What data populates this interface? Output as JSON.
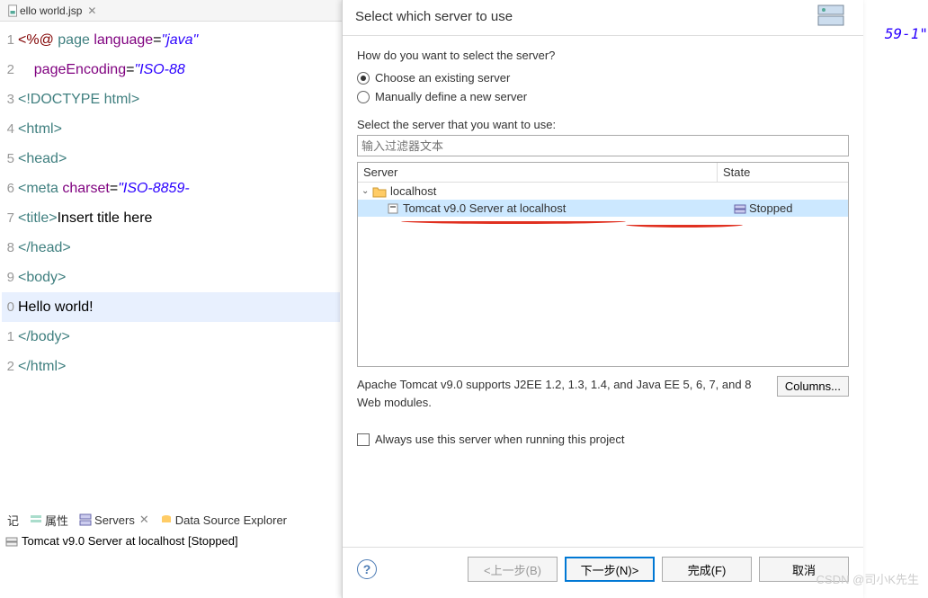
{
  "editor": {
    "tab_name": "ello world.jsp",
    "lines": [
      {
        "n": "1",
        "html": "<span class='tag-red'>&lt;%@</span> <span class='tag-teal'>page</span> <span class='attr-purple'>language</span>=<span class='attr-blue'>\"java\"</span>"
      },
      {
        "n": "2",
        "html": "    <span class='attr-purple'>pageEncoding</span>=<span class='attr-blue'>\"ISO-88</span>"
      },
      {
        "n": "3",
        "html": "<span class='tag-teal'>&lt;!DOCTYPE</span> <span class='tag-teal'>html&gt;</span>"
      },
      {
        "n": "4",
        "html": "<span class='tag-teal'>&lt;html&gt;</span>"
      },
      {
        "n": "5",
        "html": "<span class='tag-teal'>&lt;head&gt;</span>"
      },
      {
        "n": "6",
        "html": "<span class='tag-teal'>&lt;meta</span> <span class='attr-purple'>charset</span>=<span class='attr-blue'>\"ISO-8859-</span>"
      },
      {
        "n": "7",
        "html": "<span class='tag-teal'>&lt;title&gt;</span><span class='txt-black'>Insert title here</span>"
      },
      {
        "n": "8",
        "html": "<span class='tag-teal'>&lt;/head&gt;</span>"
      },
      {
        "n": "9",
        "html": "<span class='tag-teal'>&lt;body&gt;</span>"
      },
      {
        "n": "0",
        "html": "<span class='txt-black'>Hello world!</span>",
        "hl": true
      },
      {
        "n": "1",
        "html": "<span class='tag-teal'>&lt;/body&gt;</span>"
      },
      {
        "n": "2",
        "html": "<span class='tag-teal'>&lt;/html&gt;</span>"
      }
    ],
    "right_fragment": "59-1\""
  },
  "bottom": {
    "tabs": [
      "记",
      "属性",
      "Servers",
      "Data Source Explorer"
    ],
    "server_row": "Tomcat v9.0 Server at localhost  [Stopped]"
  },
  "dialog": {
    "title": "Select which server to use",
    "question": "How do you want to select the server?",
    "radio1": "Choose an existing server",
    "radio2": "Manually define a new server",
    "select_label": "Select the server that you want to use:",
    "filter_placeholder": "输入过滤器文本",
    "table": {
      "col_server": "Server",
      "col_state": "State",
      "root": "localhost",
      "item_name": "Tomcat v9.0 Server at localhost",
      "item_state": "Stopped"
    },
    "description": "Apache Tomcat v9.0 supports J2EE 1.2, 1.3, 1.4, and Java EE 5, 6, 7, and 8 Web modules.",
    "columns_btn": "Columns...",
    "checkbox_label": "Always use this server when running this project",
    "buttons": {
      "back": "<上一步(B)",
      "next": "下一步(N)>",
      "finish": "完成(F)",
      "cancel": "取消"
    }
  },
  "watermark": "CSDN @司小K先生"
}
